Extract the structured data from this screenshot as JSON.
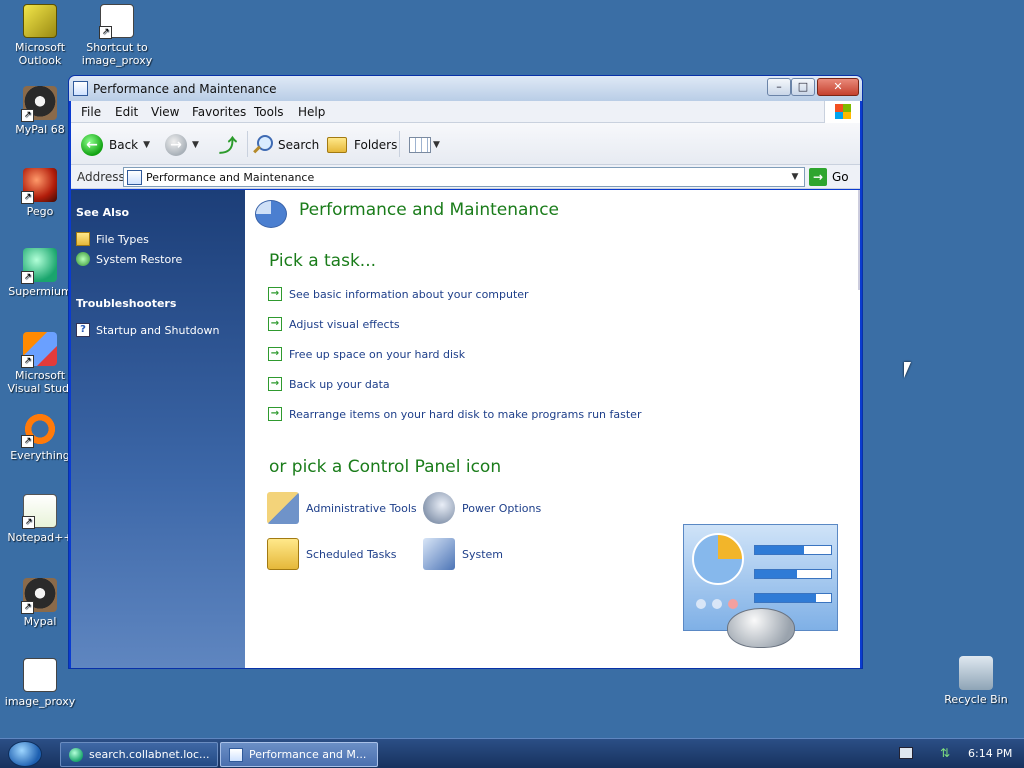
{
  "desktop": {
    "icons": [
      {
        "label": "Microsoft Outlook",
        "icon": "outlook-icon"
      },
      {
        "label": "Shortcut to image_proxy",
        "icon": "file-shortcut-icon"
      },
      {
        "label": "MyPal 68",
        "icon": "raccoon-icon"
      },
      {
        "label": "Pego",
        "icon": "pego-icon"
      },
      {
        "label": "Supermium",
        "icon": "supermium-icon"
      },
      {
        "label": "Microsoft Visual Stud.",
        "icon": "visual-studio-icon"
      },
      {
        "label": "Everything",
        "icon": "everything-icon"
      },
      {
        "label": "Notepad++",
        "icon": "notepadpp-icon"
      },
      {
        "label": "Mypal",
        "icon": "raccoon-icon"
      },
      {
        "label": "image_proxy",
        "icon": "file-icon"
      },
      {
        "label": "Recycle Bin",
        "icon": "recycle-bin-icon"
      }
    ]
  },
  "window": {
    "title": "Performance and Maintenance",
    "menu": [
      "File",
      "Edit",
      "View",
      "Favorites",
      "Tools",
      "Help"
    ],
    "toolbar": {
      "back": "Back",
      "search": "Search",
      "folders": "Folders"
    },
    "address": {
      "label": "Address",
      "value": "Performance and Maintenance",
      "go": "Go"
    },
    "sidebar": {
      "see_also": {
        "title": "See Also",
        "items": [
          "File Types",
          "System Restore"
        ]
      },
      "troubleshooters": {
        "title": "Troubleshooters",
        "items": [
          "Startup and Shutdown"
        ]
      }
    },
    "content": {
      "title": "Performance and Maintenance",
      "pick_task": "Pick a task...",
      "tasks": [
        "See basic information about your computer",
        "Adjust visual effects",
        "Free up space on your hard disk",
        "Back up your data",
        "Rearrange items on your hard disk to make programs run faster"
      ],
      "pick_icon": "or pick a Control Panel icon",
      "icons": [
        "Administrative Tools",
        "Power Options",
        "Scheduled Tasks",
        "System"
      ]
    }
  },
  "taskbar": {
    "buttons": [
      "search.collabnet.loc...",
      "Performance and M..."
    ],
    "clock": "6:14 PM"
  }
}
